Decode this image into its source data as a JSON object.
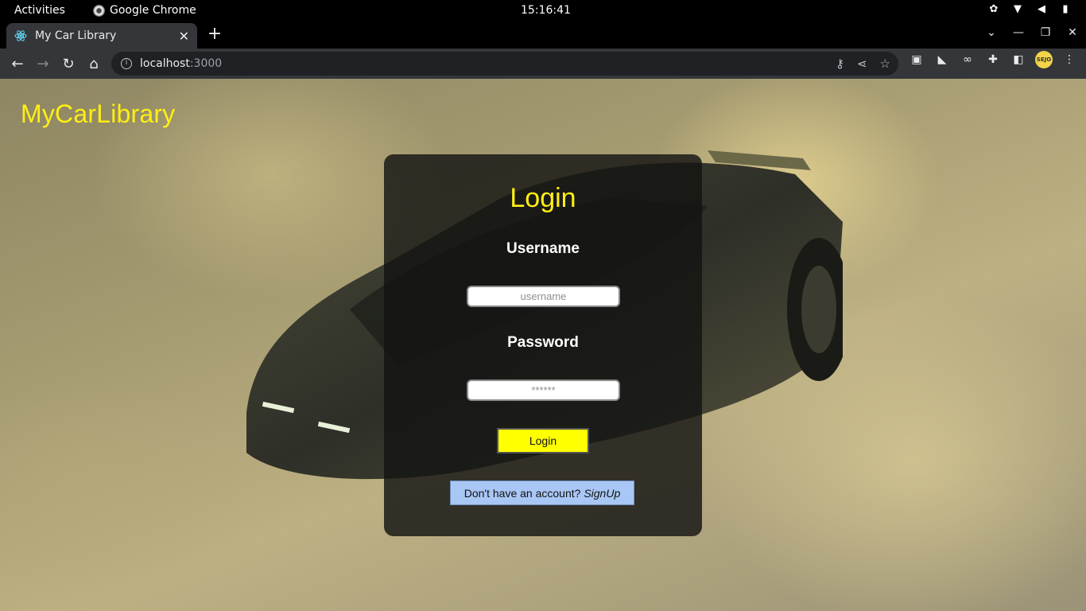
{
  "system": {
    "activities": "Activities",
    "app_name": "Google Chrome",
    "clock": "15:16:41"
  },
  "browser": {
    "tab_title": "My Car Library",
    "url_host": "localhost",
    "url_port": ":3000"
  },
  "page": {
    "brand": "MyCarLibrary",
    "card_title": "Login",
    "username_label": "Username",
    "username_placeholder": "username",
    "password_label": "Password",
    "password_placeholder": "******",
    "login_button": "Login",
    "signup_prompt": "Don't have an account?",
    "signup_link": "SignUp"
  },
  "colors": {
    "brand_yellow": "#ffef14",
    "login_button_bg": "#ffff00",
    "signup_button_bg": "#a9c7f5"
  }
}
